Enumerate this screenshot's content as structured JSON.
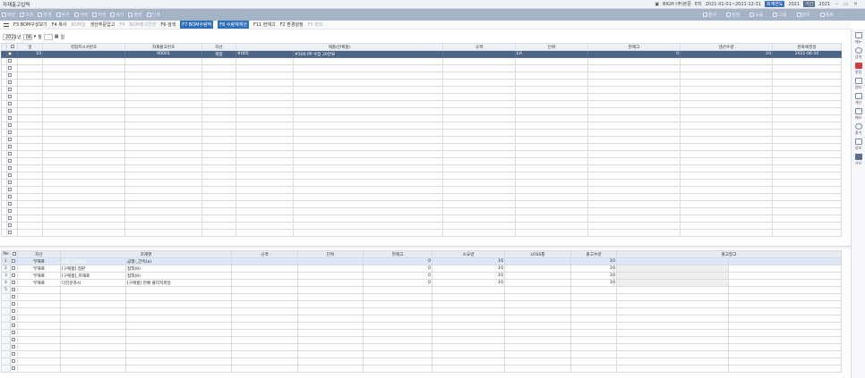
{
  "window": {
    "title": "자재출고입력",
    "company": "BIGH (주)본준",
    "user": "E치",
    "date_range": "2021-01-01~2021-12-31",
    "tag1": "회계연도",
    "year": "2021",
    "tag2": "기간",
    "year2": "2021"
  },
  "toolbar": {
    "items": [
      "화면",
      "조회",
      "환경",
      "추가",
      "삭제",
      "저장",
      "복사",
      "출력",
      "인쇄"
    ],
    "right_items": [
      "즐겨",
      "설정",
      "도움",
      "그룹",
      "정보",
      "종료"
    ]
  },
  "fkeys": [
    {
      "label": "F3 BOM구성보기",
      "state": "normal"
    },
    {
      "label": "F4 복사",
      "state": "normal"
    },
    {
      "label": "BOM일",
      "state": "dim"
    },
    {
      "label": "생산주문입고",
      "state": "normal"
    },
    {
      "label": "F4",
      "state": "dim"
    },
    {
      "label": "BOM출고반영",
      "state": "dim"
    },
    {
      "label": "F6 검색",
      "state": "normal"
    },
    {
      "label": "F7 BOM수량적",
      "state": "hl"
    },
    {
      "label": "F8 수량재계산",
      "state": "hl"
    },
    {
      "label": "F11 현재고",
      "state": "normal"
    },
    {
      "label": "F2 환경설정",
      "state": "normal"
    },
    {
      "label": "F5 정보",
      "state": "dim"
    }
  ],
  "filter": {
    "year": "2021",
    "year_unit": "년",
    "month": "06",
    "month_unit": "월",
    "day_unit": "일"
  },
  "top_grid": {
    "columns": [
      "일",
      "작업지시서번호",
      "자재출고번호",
      "자산",
      "제품(반제품)",
      "규격",
      "단위",
      "현재고",
      "생산수량",
      "완료예정일"
    ],
    "rows": [
      {
        "day": "10",
        "workorder": "",
        "issue_no": "00001",
        "asset": "제품",
        "code": "#005",
        "product": "#500 PP 수입 20번류",
        "spec": "",
        "unit": "EA",
        "stock": "0",
        "qty": "10",
        "due": "2021-06-10"
      }
    ],
    "empty_rows": 25
  },
  "bottom_grid": {
    "columns": [
      "No",
      "자산",
      "자재명",
      "규격",
      "단위",
      "현재고",
      "소요량",
      "LOSS률",
      "출고수량",
      "출고창고",
      "적요/사유"
    ],
    "rows": [
      {
        "no": "1",
        "asset": "부재료",
        "code": "금형:_간이(a)",
        "name": "금형:_간이(a)",
        "spec": "",
        "unit": "",
        "stock": "0",
        "req": "10",
        "loss": "",
        "out": "10",
        "wh": "",
        "memo": ""
      },
      {
        "no": "2",
        "asset": "부재료",
        "code": "[구매품] 접판",
        "name": "접착(0)",
        "spec": "",
        "unit": "",
        "stock": "0",
        "req": "10",
        "loss": "",
        "out": "10",
        "wh": "",
        "memo": ""
      },
      {
        "no": "3",
        "asset": "부재료",
        "code": "[구매품]_피재료",
        "name": "접착(0)",
        "spec": "",
        "unit": "",
        "stock": "0",
        "req": "10",
        "loss": "",
        "out": "10",
        "wh": "",
        "memo": ""
      },
      {
        "no": "4",
        "asset": "부재료",
        "code": "디진문자사",
        "name": "[구매품] 만배 플러치파일",
        "spec": "",
        "unit": "",
        "stock": "0",
        "req": "10",
        "loss": "",
        "out": "10",
        "wh": "",
        "memo": ""
      },
      {
        "no": "5",
        "asset": "",
        "code": "",
        "name": "",
        "spec": "",
        "unit": "",
        "stock": "",
        "req": "",
        "loss": "",
        "out": "",
        "wh": "",
        "memo": ""
      }
    ],
    "empty_rows": 11
  },
  "sidebar": {
    "items": [
      "메뉴",
      "검색",
      "알림",
      "캡처",
      "계산",
      "메모",
      "즐겨",
      "정보",
      "기타"
    ]
  },
  "colors": {
    "selected_row": "#4b6587",
    "toolbar": "#a5b3c6",
    "highlight_key": "#2f6fb7",
    "alert": "#d23c3c"
  }
}
